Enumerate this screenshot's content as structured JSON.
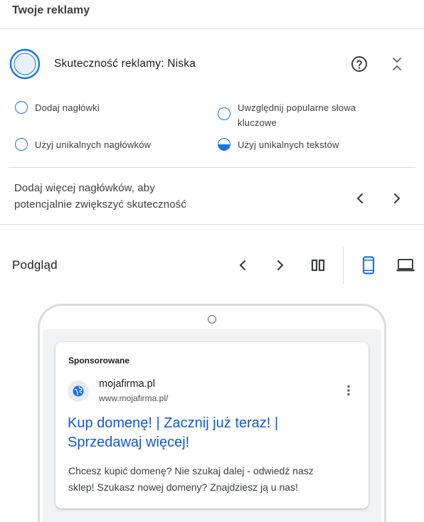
{
  "header": {
    "title": "Twoje reklamy"
  },
  "strength": {
    "label": "Skuteczność reklamy: Niska",
    "level": 0.15,
    "help_icon": "help-circle-icon",
    "collapse_icon": "collapse-icon"
  },
  "tips": [
    {
      "label": "Dodaj nagłówki",
      "progress": 0
    },
    {
      "label": "Uwzględnij popularne słowa kluczowe",
      "line1": "Uwzględnij popularne słowa",
      "line2": "kluczowe",
      "progress": 0
    },
    {
      "label": "Użyj unikalnych nagłówków",
      "progress": 0
    },
    {
      "label": "Użyj unikalnych tekstów",
      "progress": 0.5
    }
  ],
  "suggestion": {
    "line1": "Dodaj więcej nagłówków, aby",
    "line2": "potencjalnie zwiększyć skuteczność"
  },
  "preview": {
    "title": "Podgląd",
    "icons": [
      "chevron-left-icon",
      "chevron-right-icon",
      "split-view-icon",
      "mobile-icon",
      "desktop-icon"
    ]
  },
  "ad": {
    "sponsored": "Sponsorowane",
    "site_name": "mojafirma.pl",
    "site_url": "www.mojafirma.pl/",
    "headline_line1": "Kup domenę! | Zacznij już teraz! |",
    "headline_line2": "Sprzedawaj więcej!",
    "description_line1": "Chcesz kupić domenę? Nie szukaj dalej - odwiedź nasz",
    "description_line2": "sklep! Szukasz nowej domeny? Znajdziesz ją u nas!"
  },
  "colors": {
    "accent": "#1a73e8",
    "headline": "#1558d6",
    "divider": "#dadce0"
  }
}
